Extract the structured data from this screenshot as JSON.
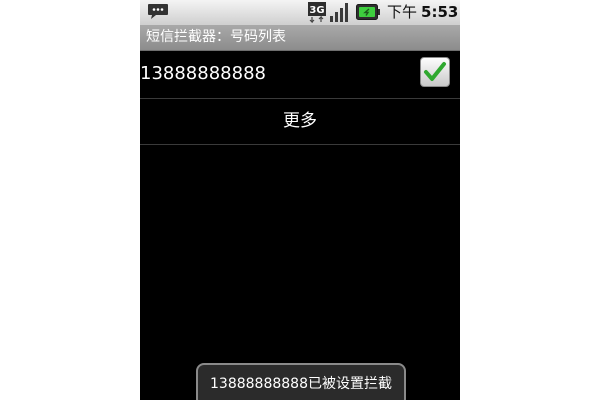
{
  "status_bar": {
    "network": "3G",
    "am_pm": "下午",
    "time": "5:53",
    "icons": [
      "sms-notification-icon",
      "3g-network-icon",
      "signal-strength-icon",
      "battery-icon"
    ]
  },
  "app": {
    "title": "短信拦截器：号码列表"
  },
  "list": {
    "items": [
      {
        "number": "13888888888",
        "checked": true
      }
    ],
    "more_label": "更多"
  },
  "toast": {
    "message": "13888888888已被设置拦截"
  },
  "colors": {
    "background": "#000000",
    "title_bar": "#9a9a9a",
    "status_bar": "#e0e0e0",
    "check_mark": "#2fa82f",
    "battery_fill": "#3ecf3e"
  }
}
